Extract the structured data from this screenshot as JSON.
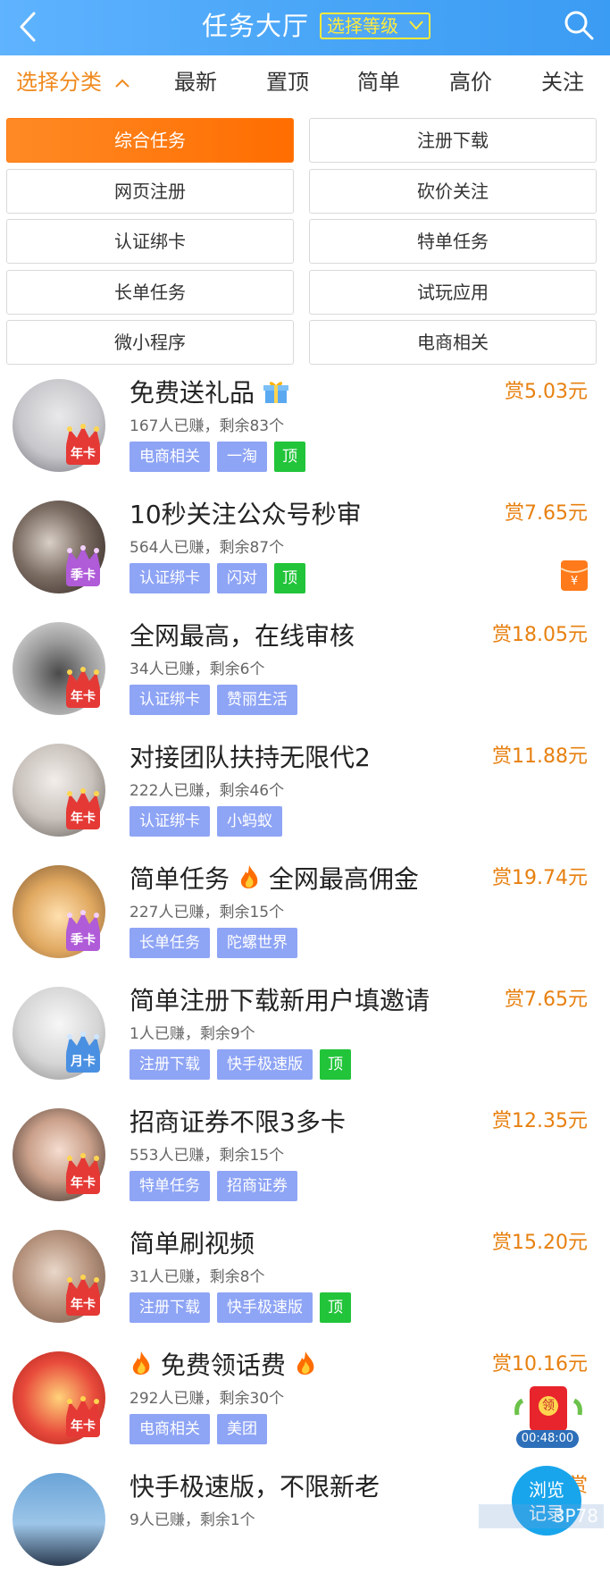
{
  "header": {
    "title": "任务大厅",
    "level_button": "选择等级"
  },
  "filters": [
    "选择分类",
    "最新",
    "置顶",
    "简单",
    "高价",
    "关注"
  ],
  "categories": [
    {
      "label": "综合任务",
      "selected": true
    },
    {
      "label": "注册下载",
      "selected": false
    },
    {
      "label": "网页注册",
      "selected": false
    },
    {
      "label": "砍价关注",
      "selected": false
    },
    {
      "label": "认证绑卡",
      "selected": false
    },
    {
      "label": "特单任务",
      "selected": false
    },
    {
      "label": "长单任务",
      "selected": false
    },
    {
      "label": "试玩应用",
      "selected": false
    },
    {
      "label": "微小程序",
      "selected": false
    },
    {
      "label": "电商相关",
      "selected": false
    }
  ],
  "colors": {
    "header": "#4aa6f7",
    "accent_orange": "#f08a1e",
    "tag_blue": "#8ea4f5",
    "tag_green": "#22c43a"
  },
  "tasks": [
    {
      "title": "免费送礼品",
      "title_icon": "gift-icon",
      "meta": "167人已赚，剩余83个",
      "reward": "赏5.03元",
      "badge": "年卡",
      "tags": [
        "电商相关",
        "一淘"
      ],
      "top": "顶"
    },
    {
      "title": "10秒关注公众号秒审",
      "meta": "564人已赚，剩余87个",
      "reward": "赏7.65元",
      "badge": "季卡",
      "tags": [
        "认证绑卡",
        "闪对"
      ],
      "top": "顶"
    },
    {
      "title": "全网最高，在线审核",
      "meta": "34人已赚，剩余6个",
      "reward": "赏18.05元",
      "badge": "年卡",
      "tags": [
        "认证绑卡",
        "赞丽生活"
      ]
    },
    {
      "title": "对接团队扶持无限代2",
      "meta": "222人已赚，剩余46个",
      "reward": "赏11.88元",
      "badge": "年卡",
      "tags": [
        "认证绑卡",
        "小蚂蚁"
      ]
    },
    {
      "title_a": "简单任务",
      "title_b": "全网最高佣金",
      "title_icon": "fire-icon",
      "meta": "227人已赚，剩余15个",
      "reward": "赏19.74元",
      "badge": "季卡",
      "tags": [
        "长单任务",
        "陀螺世界"
      ]
    },
    {
      "title": "简单注册下载新用户填邀请",
      "meta": "1人已赚，剩余9个",
      "reward": "赏7.65元",
      "badge": "月卡",
      "tags": [
        "注册下载",
        "快手极速版"
      ],
      "top": "顶"
    },
    {
      "title": "招商证券不限3多卡",
      "meta": "553人已赚，剩余15个",
      "reward": "赏12.35元",
      "badge": "年卡",
      "tags": [
        "特单任务",
        "招商证券"
      ]
    },
    {
      "title": "简单刷视频",
      "meta": "31人已赚，剩余8个",
      "reward": "赏15.20元",
      "badge": "年卡",
      "tags": [
        "注册下载",
        "快手极速版"
      ],
      "top": "顶"
    },
    {
      "title": "免费领话费",
      "title_icon": "fire-icon",
      "meta": "292人已赚，剩余30个",
      "reward": "赏10.16元",
      "badge": "年卡",
      "tags": [
        "电商相关",
        "美团"
      ]
    },
    {
      "title": "快手极速版，不限新老",
      "meta": "9人已赚，剩余1个",
      "reward": "赏",
      "tags": []
    }
  ],
  "floating": {
    "red_packet_label": "领",
    "timer": "00:48:00",
    "browse_label": "浏览",
    "browse_sub": "记录",
    "watermark": "3P78"
  }
}
